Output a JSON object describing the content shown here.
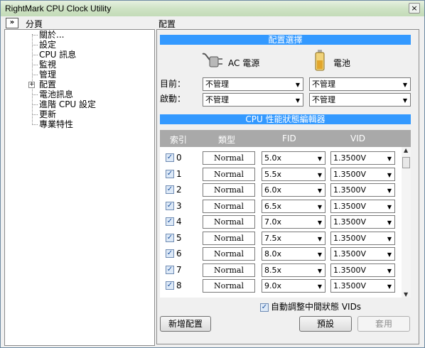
{
  "window": {
    "title": "RightMark CPU Clock Utility",
    "close_glyph": "×"
  },
  "left": {
    "collapse_glyph": "»",
    "header": "分頁",
    "items": [
      "關於...",
      "設定",
      "CPU 訊息",
      "監視",
      "管理",
      "配置",
      "電池訊息",
      "進階 CPU 設定",
      "更新",
      "專業特性"
    ],
    "expand_glyph": "+"
  },
  "right": {
    "header": "配置",
    "profile_section": "配置選擇",
    "ac_label": "AC 電源",
    "battery_label": "電池",
    "current_label": "目前：",
    "startup_label": "啟動：",
    "current_ac": "不管理",
    "current_battery": "不管理",
    "startup_ac": "不管理",
    "startup_battery": "不管理",
    "editor_section": "CPU 性能狀態編輯器",
    "columns": {
      "index": "索引",
      "type": "類型",
      "fid": "FID",
      "vid": "VID"
    },
    "rows": [
      {
        "index": "0",
        "type": "Normal",
        "fid": "5.0x",
        "vid": "1.3500V",
        "checked": "✓"
      },
      {
        "index": "1",
        "type": "Normal",
        "fid": "5.5x",
        "vid": "1.3500V",
        "checked": "✓"
      },
      {
        "index": "2",
        "type": "Normal",
        "fid": "6.0x",
        "vid": "1.3500V",
        "checked": "✓"
      },
      {
        "index": "3",
        "type": "Normal",
        "fid": "6.5x",
        "vid": "1.3500V",
        "checked": "✓"
      },
      {
        "index": "4",
        "type": "Normal",
        "fid": "7.0x",
        "vid": "1.3500V",
        "checked": "✓"
      },
      {
        "index": "5",
        "type": "Normal",
        "fid": "7.5x",
        "vid": "1.3500V",
        "checked": "✓"
      },
      {
        "index": "6",
        "type": "Normal",
        "fid": "8.0x",
        "vid": "1.3500V",
        "checked": "✓"
      },
      {
        "index": "7",
        "type": "Normal",
        "fid": "8.5x",
        "vid": "1.3500V",
        "checked": "✓"
      },
      {
        "index": "8",
        "type": "Normal",
        "fid": "9.0x",
        "vid": "1.3500V",
        "checked": "✓"
      }
    ],
    "auto_adjust_label": "自動調整中間狀態 VIDs",
    "auto_adjust_checked": "✓",
    "add_profile_button": "新增配置",
    "default_button": "預設",
    "apply_button": "套用"
  },
  "colors": {
    "section_bar": "#3399ff",
    "grid_header": "#a9a9a9",
    "titlebar": "#cfe3c5"
  }
}
